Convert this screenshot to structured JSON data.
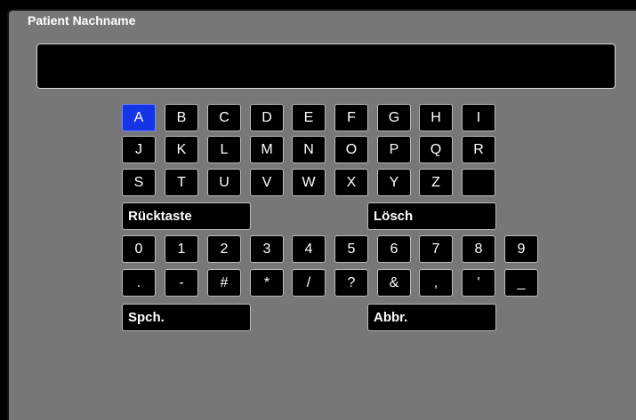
{
  "title": "Patient Nachname",
  "name_field": {
    "value": ""
  },
  "keyboard": {
    "row1": [
      "A",
      "B",
      "C",
      "D",
      "E",
      "F",
      "G",
      "H",
      "I"
    ],
    "row2": [
      "J",
      "K",
      "L",
      "M",
      "N",
      "O",
      "P",
      "Q",
      "R"
    ],
    "row3": [
      "S",
      "T",
      "U",
      "V",
      "W",
      "X",
      "Y",
      "Z",
      ""
    ],
    "backspace_label": "Rücktaste",
    "clear_label": "Lösch",
    "row4": [
      "0",
      "1",
      "2",
      "3",
      "4",
      "5",
      "6",
      "7",
      "8",
      "9"
    ],
    "row5": [
      ".",
      "-",
      "#",
      "*",
      "/",
      "?",
      "&",
      ",",
      "'",
      "_"
    ],
    "save_label": "Spch.",
    "cancel_label": "Abbr.",
    "selected_key": "A"
  },
  "colors": {
    "background": "#777777",
    "key": "#000000",
    "selected_key": "#1434e6",
    "text": "#ffffff"
  }
}
